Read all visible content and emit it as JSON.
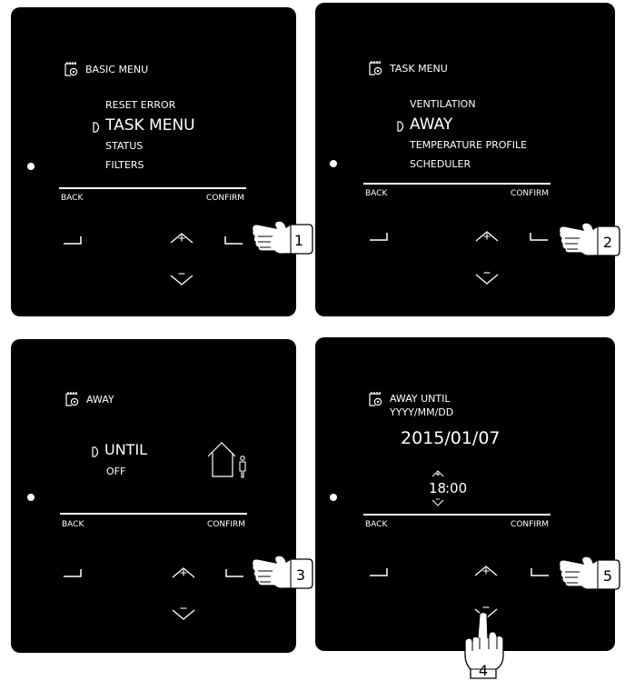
{
  "panels": [
    {
      "step": "1",
      "title": "BASIC MENU",
      "items": [
        "RESET ERROR",
        "TASK MENU",
        "STATUS",
        "FILTERS"
      ],
      "selected_index": 1,
      "back": "BACK",
      "confirm": "CONFIRM"
    },
    {
      "step": "2",
      "title": "TASK MENU",
      "items": [
        "VENTILATION",
        "AWAY",
        "TEMPERATURE PROFILE",
        "SCHEDULER"
      ],
      "selected_index": 1,
      "back": "BACK",
      "confirm": "CONFIRM"
    },
    {
      "step": "3",
      "title": "AWAY",
      "items": [
        "UNTIL",
        "OFF"
      ],
      "selected_index": 0,
      "back": "BACK",
      "confirm": "CONFIRM"
    },
    {
      "step": "5",
      "title": "AWAY UNTIL",
      "subtitle": "YYYY/MM/DD",
      "date": "2015/01/07",
      "time_hour": "18",
      "time_rest": ":00",
      "back": "BACK",
      "confirm": "CONFIRM"
    }
  ],
  "extra_step": "4",
  "icons": {
    "title_icon": "calendar-gear-icon",
    "selector": "selection-pointer-icon",
    "up": "up-plus-icon",
    "down": "down-minus-icon",
    "left_key": "left-softkey-icon",
    "right_key": "right-softkey-icon",
    "away": "house-person-icon",
    "hand": "pointing-hand-icon"
  },
  "colors": {
    "device": "#000000",
    "screen_text": "#ffffff",
    "background": "#ffffff"
  }
}
